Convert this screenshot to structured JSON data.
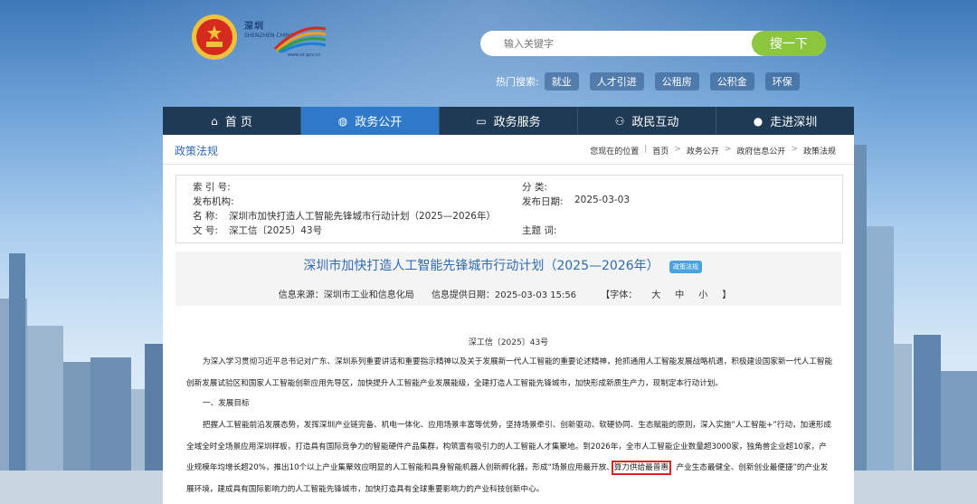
{
  "site": {
    "logo_text": "深圳",
    "logo_sub": "SHENZHEN CHINA",
    "logo_url": "www.sz.gov.cn"
  },
  "search": {
    "placeholder": "输入关键字",
    "button": "搜一下"
  },
  "hot_search": {
    "label": "热门搜索:",
    "tags": [
      "就业",
      "人才引进",
      "公租房",
      "公积金",
      "环保"
    ]
  },
  "nav": [
    {
      "label": "首 页",
      "icon": "home-icon"
    },
    {
      "label": "政务公开",
      "icon": "globe-icon"
    },
    {
      "label": "政务服务",
      "icon": "monitor-icon"
    },
    {
      "label": "政民互动",
      "icon": "people-icon"
    },
    {
      "label": "走进深圳",
      "icon": "info-icon"
    }
  ],
  "breadcrumb": {
    "section_title": "政策法规",
    "prefix": "您现在的位置",
    "items": [
      "首页",
      "政务公开",
      "政府信息公开",
      "政策法规"
    ]
  },
  "meta": {
    "index_label": "索 引 号:",
    "index_value": "",
    "category_label": "分 类:",
    "category_value": "",
    "org_label": "发布机构:",
    "org_value": "",
    "date_label": "发布日期:",
    "date_value": "2025-03-03",
    "name_label": "名 称:",
    "name_value": "深圳市加快打造人工智能先锋城市行动计划（2025—2026年）",
    "docno_label": "文 号:",
    "docno_value": "深工信〔2025〕43号",
    "topic_label": "主题 词:",
    "topic_value": ""
  },
  "doc": {
    "title": "深圳市加快打造人工智能先锋城市行动计划（2025—2026年）",
    "badge": "政策法规",
    "source": "信息来源：深圳市工业和信息化局",
    "provide_date": "信息提供日期：2025-03-03 15:56",
    "font_label": "【字体：",
    "font_large": "大",
    "font_medium": "中",
    "font_small": "小",
    "font_end": "】",
    "number": "深工信〔2025〕43号",
    "p1": "为深入学习贯彻习近平总书记对广东、深圳系列重要讲话和重要指示精神以及关于发展新一代人工智能的重要论述精神，抢抓通用人工智能发展战略机遇，积极建设国家新一代人工智能创新发展试验区和国家人工智能创新应用先导区，加快提升人工智能产业发展能级，全建打造人工智能先锋城市，加快形成新质生产力，现制定本行动计划。",
    "h1": "一、发展目标",
    "p2_a": "把握人工智能前沿发展态势，发挥深圳产业链完备、机电一体化、应用场景丰富等优势，坚持场景牵引、创新驱动、软硬协同、生态赋能的原则，深入实施“人工智能+”行动，加速形成全域全时全场景应用深圳样板，打造具有国际竞争力的智能硬件产品集群，构筑富有吸引力的人工智能人才集聚地。到2026年，全市人工智能企业数量超3000家，独角兽企业超10家，产业规模年均增长超20%，推出10个以上产业集聚效应明显的人工智能和具身智能机器人创新孵化器，形成“场景应用最开放、",
    "p2_hl": "算力供给最普惠",
    "p2_b": "、产业生态最健全、创新创业最便捷”的产业发展环境，建成具有国际影响力的人工智能先锋城市，加快打造具有全球重要影响力的产业科技创新中心。"
  }
}
